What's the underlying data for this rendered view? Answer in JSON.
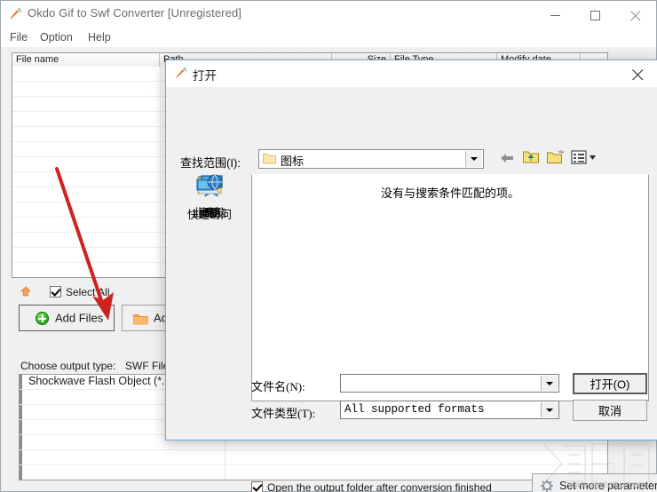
{
  "app": {
    "title": "Okdo Gif to Swf Converter [Unregistered]",
    "icon": "app-carrot-icon",
    "window_buttons": {
      "minimize": "minimize-icon",
      "maximize": "maximize-icon",
      "close": "close-icon"
    },
    "menu": [
      {
        "label": "File"
      },
      {
        "label": "Option"
      },
      {
        "label": "Help"
      }
    ],
    "file_list": {
      "columns": [
        "File name",
        "Path",
        "Size",
        "File Type",
        "Modify date"
      ],
      "rows": []
    },
    "toolbar": {
      "up_icon": "move-up-icon",
      "select_all_label": "Select All",
      "select_all_checked": true,
      "add_files_label": "Add Files",
      "add_files_icon": "green-plus-icon",
      "add_folder_label": "Add F",
      "add_folder_icon": "orange-folder-icon"
    },
    "output": {
      "choose_label": "Choose output type:",
      "selected_type": "SWF File",
      "items": [
        "Shockwave Flash Object (*.s"
      ]
    },
    "footer": {
      "open_folder_label": "Open the output folder after conversion finished",
      "open_folder_checked": true,
      "set_more_label": "Set more parameters",
      "set_more_icon": "gear-icon"
    }
  },
  "dialog": {
    "title": "打开",
    "icon": "app-carrot-icon",
    "close_icon": "close-icon",
    "look_in_label": "查找范围(I):",
    "look_in_value": "图标",
    "look_in_icon": "folder-icon",
    "toolbar": [
      {
        "name": "back-icon",
        "label": ""
      },
      {
        "name": "up-folder-icon",
        "label": ""
      },
      {
        "name": "new-folder-icon",
        "label": ""
      },
      {
        "name": "view-menu-icon",
        "label": ""
      }
    ],
    "places": [
      {
        "label": "快速访问",
        "icon": "star-icon"
      },
      {
        "label": "桌面",
        "icon": "desktop-icon"
      },
      {
        "label": "库",
        "icon": "library-folder-icon"
      },
      {
        "label": "此电脑",
        "icon": "this-pc-icon"
      },
      {
        "label": "网络",
        "icon": "network-icon"
      }
    ],
    "empty_message": "没有与搜索条件匹配的项。",
    "file_name_label": "文件名(N):",
    "file_name_value": "",
    "file_type_label": "文件类型(T):",
    "file_type_value": "All supported formats",
    "open_button": "打开(O)",
    "cancel_button": "取消"
  },
  "annotation": {
    "arrow_color": "#cc2222",
    "points_to": "add-files-button"
  },
  "watermark": {
    "text": "www.xiazaiba.com"
  }
}
